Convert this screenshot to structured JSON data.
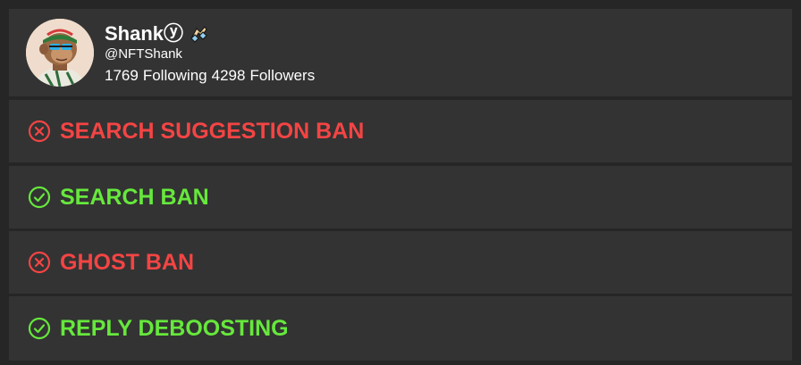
{
  "profile": {
    "name": "Shankⓨ",
    "handle": "@NFTShank",
    "following_count": "1769",
    "following_label": "Following",
    "followers_count": "4298",
    "followers_label": "Followers",
    "badge_icon": "diamond-hands-emoji-icon"
  },
  "checks": [
    {
      "label": "SEARCH SUGGESTION BAN",
      "status": "banned",
      "icon": "x-circle-icon",
      "color": "#f44444"
    },
    {
      "label": "SEARCH BAN",
      "status": "ok",
      "icon": "check-circle-icon",
      "color": "#66e83c"
    },
    {
      "label": "GHOST BAN",
      "status": "banned",
      "icon": "x-circle-icon",
      "color": "#f44444"
    },
    {
      "label": "REPLY DEBOOSTING",
      "status": "ok",
      "icon": "check-circle-icon",
      "color": "#66e83c"
    }
  ],
  "colors": {
    "background": "#262626",
    "card": "#333333",
    "text": "#ffffff",
    "banned": "#f44444",
    "ok": "#66e83c"
  }
}
